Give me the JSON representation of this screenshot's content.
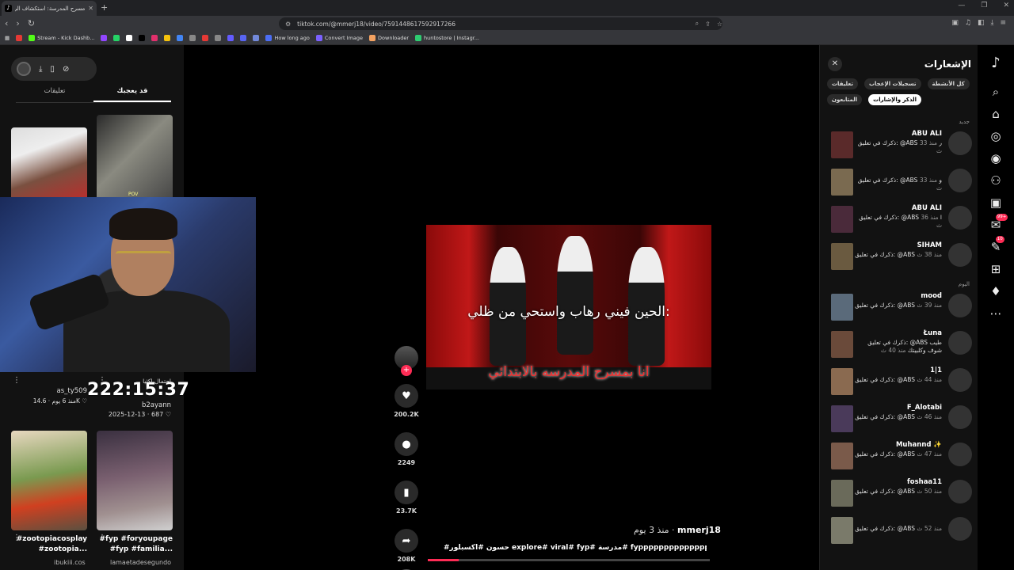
{
  "browser": {
    "tab_title": "مسرح المدرسة: استكشاف الرهاب",
    "url": "tiktok.com/@mmerj18/video/7591448617592917266",
    "bookmarks": [
      {
        "label": "",
        "color": "#e53935"
      },
      {
        "label": "Stream - Kick Dashb...",
        "color": "#53fc18"
      },
      {
        "label": "",
        "color": "#9146ff"
      },
      {
        "label": "",
        "color": "#25d366"
      },
      {
        "label": "",
        "color": "#ffffff"
      },
      {
        "label": "",
        "color": "#000000"
      },
      {
        "label": "",
        "color": "#e1306c"
      },
      {
        "label": "",
        "color": "#f4c20d"
      },
      {
        "label": "",
        "color": "#4285f4"
      },
      {
        "label": "",
        "color": "#888888"
      },
      {
        "label": "",
        "color": "#e53935"
      },
      {
        "label": "",
        "color": "#888888"
      },
      {
        "label": "",
        "color": "#635bff"
      },
      {
        "label": "",
        "color": "#5865f2"
      },
      {
        "label": "",
        "color": "#7289da"
      },
      {
        "label": "How long ago",
        "color": "#4c6ef5"
      },
      {
        "label": "Convert Image",
        "color": "#7b61ff"
      },
      {
        "label": "Downloader",
        "color": "#f4a261"
      },
      {
        "label": "huntostore | Instagr...",
        "color": "#2ecc71"
      }
    ]
  },
  "left_panel": {
    "tabs": [
      "تعليقات",
      "قد يعجبك"
    ],
    "active_tab": "قد يعجبك",
    "clock": "222:15:37",
    "video_a": {
      "pov": "POV",
      "likes": "14.6K",
      "age": "منذ 6 يوم",
      "author": "as_ty509"
    },
    "video_b": {
      "title": "احتمال اكثيا",
      "author": "b2ayann",
      "likes": "687",
      "date": "2025-12-13"
    },
    "video_c": {
      "caption": "#zootopiacosplay #zootopia...",
      "author": "ibukiii.cos"
    },
    "video_d": {
      "caption": "#fyp #foryoupage #fyp #familia...",
      "author": "lamaetadesegundo"
    }
  },
  "video": {
    "overlay_text": "الحين فيني رهاب واستحي من ظلي:",
    "overlay_red": "انا بمسرح المدرسه بالابتدائي",
    "username": "mmerj18",
    "posted": "منذ 3 يوم",
    "description": "#حسون #اكسبلور explore# viral# fyp# مدرسة# fypppppppppppppppppppppp ...",
    "likes": "200.2K",
    "comments": "2249",
    "saves": "23.7K",
    "shares": "208K",
    "progress": 0.11
  },
  "notifications": {
    "title": "الإشعارات",
    "chips": [
      "كل الأنشطة",
      "تسجيلات الإعجاب",
      "تعليقات",
      "الذكر والإشارات",
      "المتابعون"
    ],
    "active_chip": "الذكر والإشارات",
    "section_new": "جديد",
    "section_today": "اليوم",
    "items": [
      {
        "name": "ABU ALI",
        "text": "ذكرك في تعليق: @ABS ر",
        "time": "منذ 33 ث"
      },
      {
        "name": "",
        "text": "ذكرك في تعليق: @ABS و",
        "time": "منذ 33 ث"
      },
      {
        "name": "ABU ALI",
        "text": "ذكرك في تعليق: @ABS ا",
        "time": "منذ 36 ث"
      },
      {
        "name": "SIHAM",
        "text": "ذكرك في تعليق: @ABS",
        "time": "منذ 38 ث"
      },
      {
        "name": "mood",
        "text": "ذكرك في تعليق: @ABS",
        "time": "منذ 39 ث"
      },
      {
        "name": "Łuna",
        "text": "ذكرك في تعليق: @ABS طيب شوف وكلبيتك",
        "time": "منذ 40 ث"
      },
      {
        "name": "1|1",
        "text": "ذكرك في تعليق: @ABS",
        "time": "منذ 44 ث"
      },
      {
        "name": "F_Alotabi",
        "text": "ذكرك في تعليق: @ABS",
        "time": "منذ 46 ث"
      },
      {
        "name": "Muhannd ✨",
        "text": "ذكرك في تعليق: @ABS",
        "time": "منذ 47 ث"
      },
      {
        "name": "foshaa11",
        "text": "ذكرك في تعليق: @ABS",
        "time": "منذ 50 ث"
      },
      {
        "name": "",
        "text": "ذكرك في تعليق: @ABS",
        "time": "منذ 52 ث"
      }
    ]
  },
  "right_nav": {
    "inbox_badge": "99+",
    "messages_badge": "10"
  }
}
